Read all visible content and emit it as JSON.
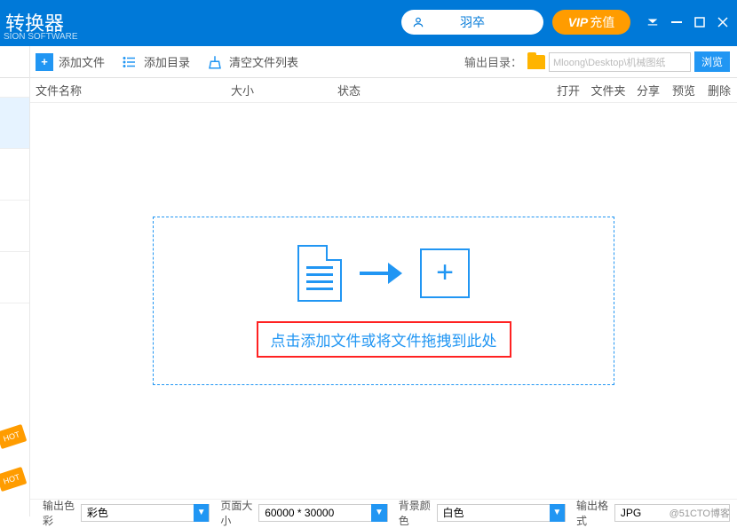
{
  "header": {
    "title": "转换器",
    "subtitle": "SION SOFTWARE",
    "username": "羽卒",
    "vip_label": "充值",
    "vip_prefix": "VIP"
  },
  "toolbar": {
    "add_file": "添加文件",
    "add_dir": "添加目录",
    "clear_list": "清空文件列表",
    "output_dir_label": "输出目录：",
    "output_path": "Mloong\\Desktop\\机械图纸",
    "browse": "浏览"
  },
  "columns": {
    "name": "文件名称",
    "size": "大小",
    "status": "状态",
    "open": "打开",
    "folder": "文件夹",
    "share": "分享",
    "preview": "预览",
    "delete": "删除"
  },
  "dropzone": {
    "text": "点击添加文件或将文件拖拽到此处"
  },
  "bottom": {
    "color_label": "输出色彩",
    "color_value": "彩色",
    "page_label": "页面大小",
    "page_value": "60000 * 30000",
    "bg_label": "背景颜色",
    "bg_value": "白色",
    "fmt_label": "输出格式",
    "fmt_value": "JPG"
  },
  "badges": {
    "hot": "HOT"
  },
  "watermark": "@51CTO博客"
}
